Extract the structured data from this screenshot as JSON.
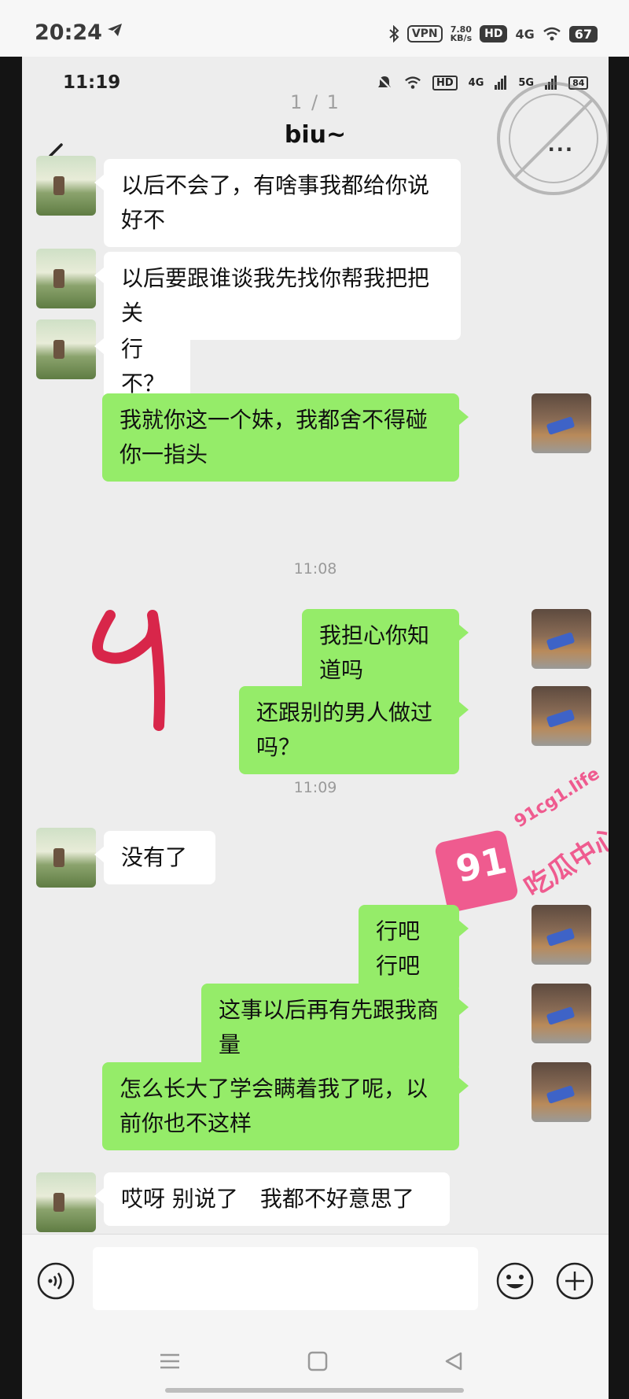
{
  "outer_status": {
    "time": "20:24",
    "vpn": "VPN",
    "speed": "7.80",
    "speed_unit": "KB/s",
    "hd": "HD",
    "network": "4G",
    "battery": "67"
  },
  "inner_status": {
    "time": "11:19",
    "hd": "HD",
    "net1": "4G",
    "net2": "5G",
    "battery": "84"
  },
  "viewer": {
    "page_counter": "1 / 1"
  },
  "chat": {
    "title": "biu~",
    "more": "···"
  },
  "messages": [
    {
      "side": "left",
      "text": "以后不会了，有啥事我都给你说好不"
    },
    {
      "side": "left",
      "text": "以后要跟谁谈我先找你帮我把把关"
    },
    {
      "side": "left",
      "text": "行不？"
    },
    {
      "side": "right",
      "text": "我就你这一个妹，我都舍不得碰你一指头"
    },
    {
      "side": "right",
      "text": "我担心你知道吗"
    },
    {
      "side": "right",
      "text": "还跟别的男人做过吗？"
    },
    {
      "side": "left",
      "text": "没有了"
    },
    {
      "side": "right",
      "text": "行吧　行吧"
    },
    {
      "side": "right",
      "text": "这事以后再有先跟我商量"
    },
    {
      "side": "right",
      "text": "怎么长大了学会瞒着我了呢，以前你也不这样"
    },
    {
      "side": "left",
      "text": "哎呀 别说了　我都不好意思了"
    }
  ],
  "timestamps": [
    "11:08",
    "11:09"
  ],
  "watermark": {
    "number": "91",
    "domain": "91cg1.life",
    "name": "吃瓜中心"
  },
  "input": {
    "value": ""
  },
  "colors": {
    "right_bubble": "#95ec69",
    "left_bubble": "#ffffff",
    "background": "#ededed",
    "watermark": "#ef5b8f",
    "annotation": "#d8264a"
  },
  "icons": [
    "telegram-icon",
    "bluetooth-icon",
    "wifi-icon",
    "signal-icon",
    "back-icon",
    "more-icon",
    "voice-icon",
    "emoji-icon",
    "plus-icon",
    "menu-icon",
    "home-icon",
    "nav-back-icon"
  ]
}
